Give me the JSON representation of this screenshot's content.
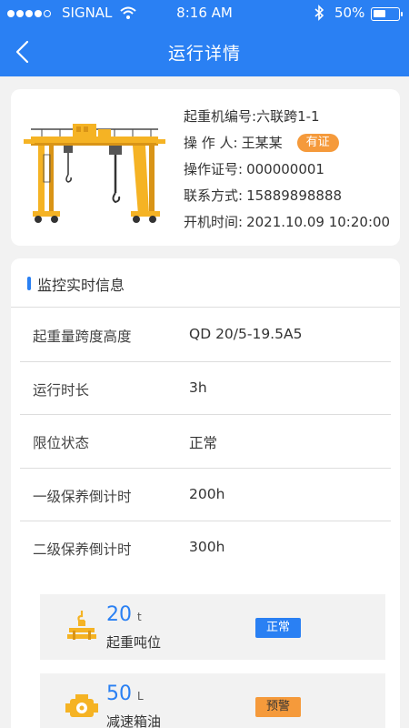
{
  "status_bar": {
    "carrier": "SIGNAL",
    "time": "8:16 AM",
    "battery": "50%",
    "battery_level": 0.5
  },
  "nav": {
    "title": "运行详情",
    "back_icon": "chevron-left-icon"
  },
  "crane": {
    "image": "gantry-crane-illustration",
    "id_label": "起重机编号:",
    "id_value": "六联跨1-1",
    "operator_label": "操 作 人:",
    "operator_value": "王某某",
    "cert_tag": "有证",
    "cert_label": "操作证号:",
    "cert_value": "000000001",
    "contact_label": "联系方式:",
    "contact_value": "15889898888",
    "start_label": "开机时间:",
    "start_value": "2021.10.09 10:20:00"
  },
  "monitor": {
    "title": "监控实时信息",
    "rows": [
      {
        "label": "起重量跨度高度",
        "value": "QD 20/5-19.5A5"
      },
      {
        "label": "运行时长",
        "value": "3h"
      },
      {
        "label": "限位状态",
        "value": "正常"
      },
      {
        "label": "一级保养倒计时",
        "value": "200h"
      },
      {
        "label": "二级保养倒计时",
        "value": "300h"
      }
    ],
    "metrics": [
      {
        "value": "20",
        "unit": "t",
        "label": "起重吨位",
        "status": "正常",
        "icon": "hoist-load-icon",
        "status_color": "#2a80f3"
      },
      {
        "value": "50",
        "unit": "L",
        "label": "减速箱油",
        "status": "预警",
        "icon": "gearbox-oil-icon",
        "status_color": "#f59a3b"
      }
    ]
  },
  "colors": {
    "primary": "#2a80f3",
    "accent": "#f59a3b",
    "crane_yellow": "#f5b324"
  }
}
